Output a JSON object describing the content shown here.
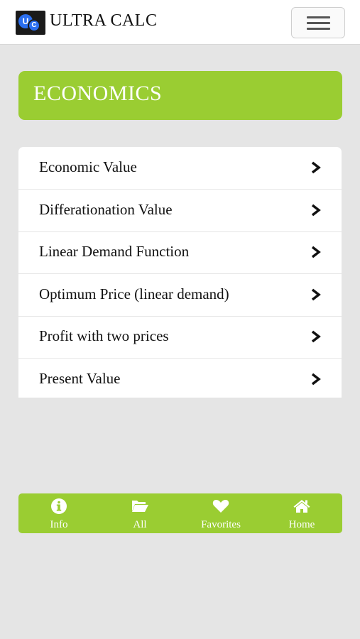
{
  "app": {
    "title": "ULTRA CALC",
    "logo_text_u": "U",
    "logo_text_c": "C"
  },
  "category": {
    "title": "ECONOMICS"
  },
  "list": {
    "items": [
      {
        "label": "Economic Value"
      },
      {
        "label": "Differationation Value"
      },
      {
        "label": "Linear Demand Function"
      },
      {
        "label": "Optimum Price (linear demand)"
      },
      {
        "label": "Profit with two prices"
      },
      {
        "label": "Present Value"
      }
    ],
    "chevron_icon": "chevron-right-icon"
  },
  "bottom_nav": {
    "items": [
      {
        "label": "Info",
        "icon": "info-icon"
      },
      {
        "label": "All",
        "icon": "folder-open-icon"
      },
      {
        "label": "Favorites",
        "icon": "heart-icon"
      },
      {
        "label": "Home",
        "icon": "home-icon"
      }
    ]
  },
  "colors": {
    "accent": "#9acd32",
    "background": "#e5e5e5",
    "logo_blue": "#2b6ff0"
  }
}
